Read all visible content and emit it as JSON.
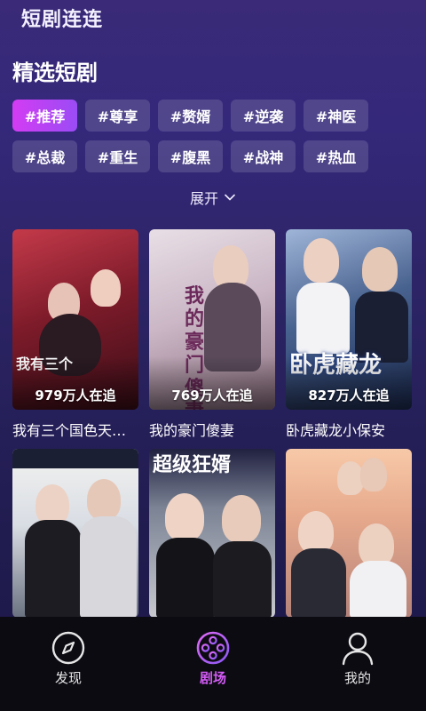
{
  "header": {
    "app_title": "短剧连连"
  },
  "section": {
    "title": "精选短剧"
  },
  "tags": [
    "#推荐",
    "#尊享",
    "#赘婿",
    "#逆袭",
    "#神医",
    "#总裁",
    "#重生",
    "#腹黑",
    "#战神",
    "#热血"
  ],
  "active_tag_index": 0,
  "expand_label": "展开",
  "dramas": [
    {
      "name": "我有三个国色天香的...",
      "viewers": "979万人在追",
      "poster_text": "我有三个"
    },
    {
      "name": "我的豪门傻妻",
      "viewers": "769万人在追",
      "poster_text": "我的豪门傻妻"
    },
    {
      "name": "卧虎藏龙小保安",
      "viewers": "827万人在追",
      "poster_text": "卧虎藏龙"
    },
    {
      "name": "",
      "viewers": "",
      "poster_text": ""
    },
    {
      "name": "",
      "viewers": "",
      "poster_text": "超级狂婿"
    },
    {
      "name": "",
      "viewers": "",
      "poster_text": ""
    }
  ],
  "tabbar": {
    "items": [
      {
        "label": "发现",
        "icon": "compass-icon"
      },
      {
        "label": "剧场",
        "icon": "film-reel-icon"
      },
      {
        "label": "我的",
        "icon": "person-icon"
      }
    ],
    "active_index": 1,
    "active_color": "#d35cf5"
  }
}
